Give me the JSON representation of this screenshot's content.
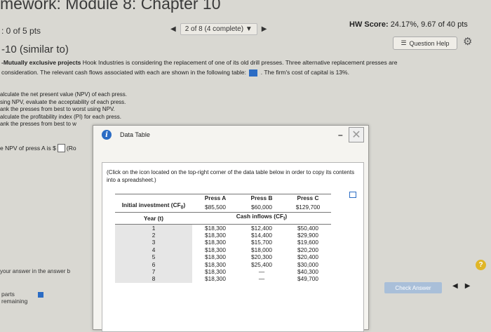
{
  "header": {
    "title": "mework: Module 8: Chapter 10",
    "question_points": ": 0 of 5 pts",
    "nav_prev": "◀",
    "nav_text": "2 of 8 (4 complete)",
    "nav_dropdown": "▼",
    "nav_next": "▶",
    "hw_score_label": "HW Score:",
    "hw_score_value": "24.17%, 9.67 of 40 pts",
    "question_number": "-10 (similar to)",
    "question_help": "Question Help"
  },
  "problem": {
    "lead_bold": "-Mutually exclusive projects",
    "line1": "Hook Industries is considering the replacement of one of its old drill presses. Three alternative replacement presses are",
    "line2_a": "consideration. The relevant cash flows associated with each are shown in the following table:",
    "line2_b": ". The firm's cost of capital is 13%."
  },
  "tasks": [
    "alculate the net present value (NPV) of each press.",
    "sing NPV, evaluate the acceptability of each press.",
    "ank the presses from best to worst using NPV.",
    "alculate the profitability index (PI) for each press.",
    "ank the presses from best to w"
  ],
  "npv_prompt": {
    "label": "e NPV of press A is $",
    "suffix": "(Ro"
  },
  "answer_hint": "your answer in the answer b",
  "parts": {
    "line1": "parts",
    "line2": "remaining"
  },
  "check_answer": "Check Answer",
  "help_q": "?",
  "modal": {
    "title": "Data Table",
    "minimize": "–",
    "close": "✕",
    "instructions": "(Click on the icon located on the top-right corner of the data table below in order to copy its contents into a spreadsheet.)",
    "table": {
      "headers": [
        "Press A",
        "Press B",
        "Press C"
      ],
      "initial_label": "Initial investment (CF",
      "initial_sub": "0",
      "initial_close": ")",
      "initial_values": [
        "$85,500",
        "$60,000",
        "$129,700"
      ],
      "year_label": "Year (t)",
      "cf_label": "Cash inflows (CF",
      "cf_sub": "t",
      "cf_close": ")",
      "rows": [
        {
          "year": "1",
          "a": "$18,300",
          "b": "$12,400",
          "c": "$50,400"
        },
        {
          "year": "2",
          "a": "$18,300",
          "b": "$14,400",
          "c": "$29,900"
        },
        {
          "year": "3",
          "a": "$18,300",
          "b": "$15,700",
          "c": "$19,600"
        },
        {
          "year": "4",
          "a": "$18,300",
          "b": "$18,000",
          "c": "$20,200"
        },
        {
          "year": "5",
          "a": "$18,300",
          "b": "$20,300",
          "c": "$20,400"
        },
        {
          "year": "6",
          "a": "$18,300",
          "b": "$25,400",
          "c": "$30,000"
        },
        {
          "year": "7",
          "a": "$18,300",
          "b": "—",
          "c": "$40,300"
        },
        {
          "year": "8",
          "a": "$18,300",
          "b": "—",
          "c": "$49,700"
        }
      ]
    }
  }
}
